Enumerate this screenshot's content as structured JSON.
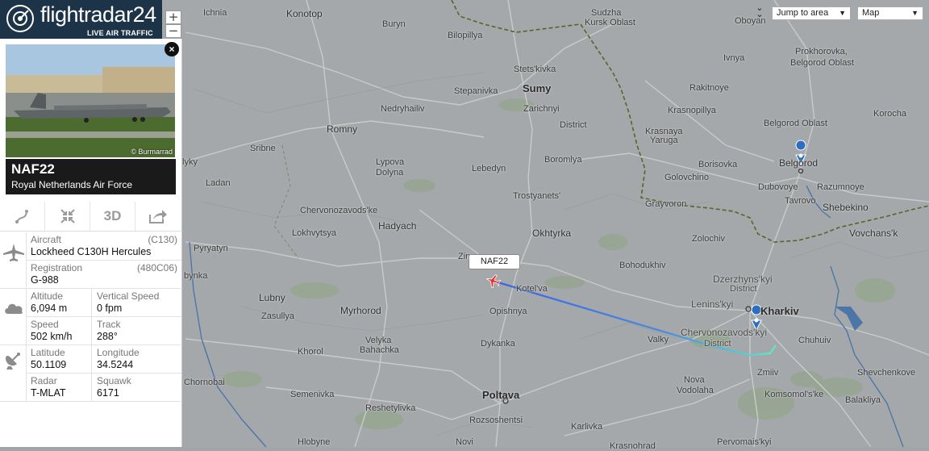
{
  "brand": {
    "name": "flightradar24",
    "subtitle": "LIVE AIR TRAFFIC"
  },
  "zoom": {
    "in": "+",
    "out": "−"
  },
  "controls": {
    "jump_to_area": "Jump to area",
    "map_type": "Map"
  },
  "flight": {
    "callsign": "NAF22",
    "airline": "Royal Netherlands Air Force",
    "photo_credit": "© Burmarrad",
    "map_label": "NAF22"
  },
  "toolbar": {
    "route_icon": "route-icon",
    "fit_icon": "fit-view-icon",
    "view3d": "3D",
    "share_icon": "share-icon"
  },
  "details": {
    "aircraft_label": "Aircraft",
    "aircraft_code": "(C130)",
    "aircraft_value": "Lockheed C130H Hercules",
    "registration_label": "Registration",
    "registration_code": "(480C06)",
    "registration_value": "G-988",
    "altitude_label": "Altitude",
    "altitude_value": "6,094 m",
    "vspeed_label": "Vertical Speed",
    "vspeed_value": "0 fpm",
    "speed_label": "Speed",
    "speed_value": "502 km/h",
    "track_label": "Track",
    "track_value": "288°",
    "latitude_label": "Latitude",
    "latitude_value": "50.1109",
    "longitude_label": "Longitude",
    "longitude_value": "34.5244",
    "radar_label": "Radar",
    "radar_value": "T-MLAT",
    "squawk_label": "Squawk",
    "squawk_value": "6171"
  },
  "map": {
    "colors": {
      "land": "#a5a8aa",
      "road": "#c7c8c9",
      "border": "#5b6a2b",
      "river": "#4e76a6",
      "green": "#92a48c",
      "track_start": "#3f6fe0",
      "track_end": "#4ee3c9",
      "marker": "#3c78c8"
    },
    "places": [
      "Konotop",
      "Ichnia",
      "Buryn",
      "Bilopillya",
      "Sudzha",
      "Kursk Oblast",
      "Oboyan",
      "Stets'kivka",
      "Ivnya",
      "Prokhorovka,",
      "Belgorod Oblast",
      "Stepanivka",
      "Sumy",
      "Zarichnyi",
      "District",
      "Krasnopillya",
      "Rakitnoye",
      "Nedryhailiv",
      "Krasnaya",
      "Yaruga",
      "Korocha",
      "Romny",
      "Belgorod Oblast",
      "Sribne",
      "Lypova",
      "Dolyna",
      "Boromlya",
      "Borisovka",
      "Belgorod",
      "lyky",
      "Lebedyn",
      "Golovchino",
      "Dubovoye",
      "Razumnoye",
      "Ladan",
      "Trostyanets'",
      "Tavrovo",
      "Grayvoron",
      "Shebekino",
      "Chervonozavods'ke",
      "Zolochiv",
      "Vovchans'k",
      "Lokhvytsya",
      "Hadyach",
      "Okhtyrka",
      "Pyryatyn",
      "Bohodukhiv",
      "Dzerzhyns'kyi",
      "District",
      "Lenins'kyi",
      "Kharkiv",
      "bynka",
      "Lubny",
      "Myrhorod",
      "Kotel'va",
      "Chervonozavods'kyi",
      "District",
      "Zasullya",
      "Opishnya",
      "Valky",
      "Chuhuiv",
      "Velyka",
      "Bahachka",
      "Khorol",
      "Dykanka",
      "Zmiiv",
      "Shevchenkove",
      "Nova",
      "Vodolaha",
      "Chornobai",
      "Semenivka",
      "Poltava",
      "Komsomol's'ke",
      "Balakliya",
      "Reshetylivka",
      "Rozsoshentsi",
      "Karlivka",
      "Hlobyne",
      "Novi",
      "Krasnohrad",
      "Pervomais'kyi",
      "Zin"
    ]
  }
}
